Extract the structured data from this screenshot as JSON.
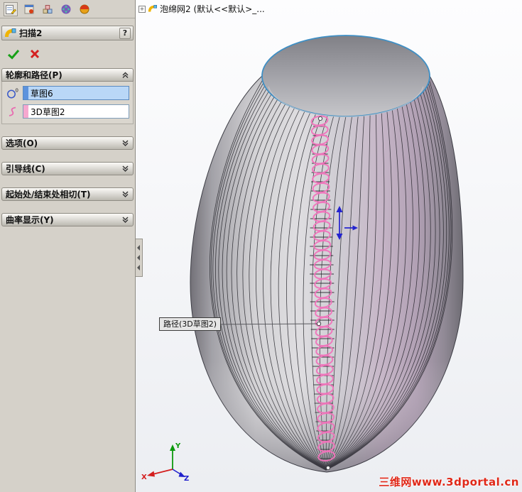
{
  "colors": {
    "panel_bg": "#d5d1c9",
    "accent_blue_rim": "#3f8fc4",
    "selection_field_blue": "#b9d7f7",
    "selection_bar_blue": "#5d93dd",
    "path_pink": "#f173bb",
    "path_bar_pink": "#f6a8cf",
    "check_green": "#17a017",
    "cancel_red": "#d42020",
    "watermark_red": "#e02818",
    "triad_x_red": "#d41e1e",
    "triad_y_green": "#0c9a0c",
    "triad_z_blue": "#2020cc"
  },
  "icons": {
    "panel_tabs": [
      "property-manager-tab-icon",
      "document-tab-icon",
      "configuration-tab-icon",
      "dimxpert-tab-icon",
      "display-manager-tab-icon"
    ],
    "title_icon": "sweep-feature-icon",
    "profile_icon": "profile-sketch-icon",
    "path_icon": "path-3dsketch-icon",
    "ok_icon": "check-icon",
    "cancel_icon": "cross-icon",
    "expanded_icon": "chevron-up-icon",
    "collapsed_icon": "chevron-down-icon",
    "tree_expand_icon": "plus-box-icon"
  },
  "panel": {
    "title": "扫描2",
    "help_label": "?",
    "groups": [
      {
        "id": "profile-path",
        "label": "轮廓和路径(P)",
        "expanded": true
      },
      {
        "id": "options",
        "label": "选项(O)",
        "expanded": false
      },
      {
        "id": "guide-curves",
        "label": "引导线(C)",
        "expanded": false
      },
      {
        "id": "start-end-tangency",
        "label": "起始处/结束处相切(T)",
        "expanded": false
      },
      {
        "id": "curvature-display",
        "label": "曲率显示(Y)",
        "expanded": false
      }
    ],
    "profile_value": "草图6",
    "path_value": "3D草图2"
  },
  "viewport": {
    "tree_expand_glyph": "+",
    "tree_item_label": "泡绵网2 (默认<<默认>_...",
    "callout_label": "路径(3D草图2)",
    "watermark": "三维网www.3dportal.cn",
    "triad": {
      "x_label": "X",
      "y_label": "Y",
      "z_label": "Z"
    }
  }
}
